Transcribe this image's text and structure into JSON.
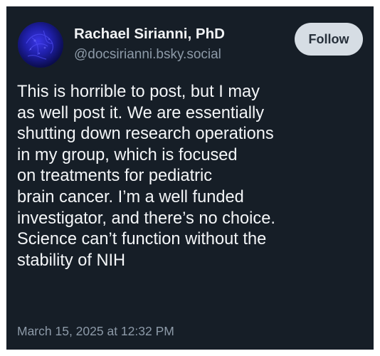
{
  "post": {
    "author": {
      "display_name": "Rachael Sirianni, PhD",
      "handle": "@docsirianni.bsky.social",
      "avatar_icon": "profile-avatar"
    },
    "follow_label": "Follow",
    "text_lines": [
      "This is horrible to post, but I may",
      "as well post it. We are essentially",
      "shutting down research operations",
      "in my group, which is focused",
      "on treatments for pediatric",
      "brain cancer. I’m a well funded",
      "investigator, and there’s no choice.",
      "Science can’t function without the",
      "stability of NIH"
    ],
    "timestamp": "March 15, 2025 at 12:32 PM"
  },
  "colors": {
    "background": "#161e27",
    "primary_text": "#f4f6f8",
    "secondary_text": "#8d9aa8",
    "follow_button_bg": "#d6dde4",
    "follow_button_text": "#262f3a",
    "avatar_blue": "#1b1f9c"
  }
}
